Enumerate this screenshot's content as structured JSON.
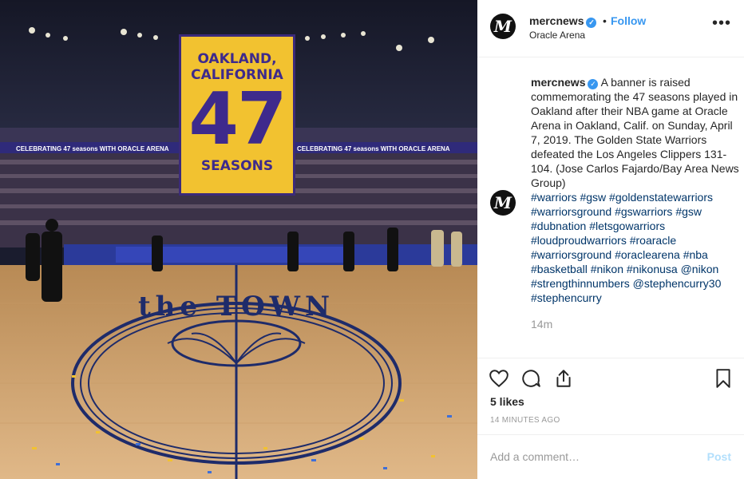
{
  "post": {
    "username": "mercnews",
    "follow_label": "Follow",
    "location": "Oracle Arena",
    "avatar_letter": "M",
    "more_label": "•••"
  },
  "photo": {
    "banner_city": "OAKLAND, CALIFORNIA",
    "banner_number": "47",
    "banner_word": "SEASONS",
    "court_text": "the TOWN",
    "ribbon_text": "CELEBRATING 47 seasons WITH ORACLE ARENA"
  },
  "caption": {
    "username": "mercnews",
    "text": "A banner is raised commemorating the 47 seasons played in Oakland after their NBA game at Oracle Arena in Oakland, Calif. on Sunday, April 7, 2019. The Golden State Warriors defeated the Los Angeles Clippers 131-104. (Jose Carlos Fajardo/Bay Area News Group)",
    "hashtags": [
      "#warriors",
      "#gsw",
      "#goldenstatewarriors",
      "#warriorsground",
      "#gswarriors",
      "#gsw",
      "#dubnation",
      "#letsgowarriors",
      "#loudproudwarriors",
      "#roaracle",
      "#warriorsground",
      "#oraclearena",
      "#nba",
      "#basketball",
      "#nikon",
      "#nikonusa",
      "@nikon",
      "#strengthinnumbers",
      "@stephencurry30",
      "#stephencurry"
    ],
    "age": "14m"
  },
  "engagement": {
    "likes": "5 likes",
    "timestamp": "14 MINUTES AGO"
  },
  "comment": {
    "placeholder": "Add a comment…",
    "post_label": "Post"
  },
  "colors": {
    "accent": "#3897f0",
    "banner_yellow": "#f2c230",
    "banner_purple": "#3e2a8c"
  }
}
